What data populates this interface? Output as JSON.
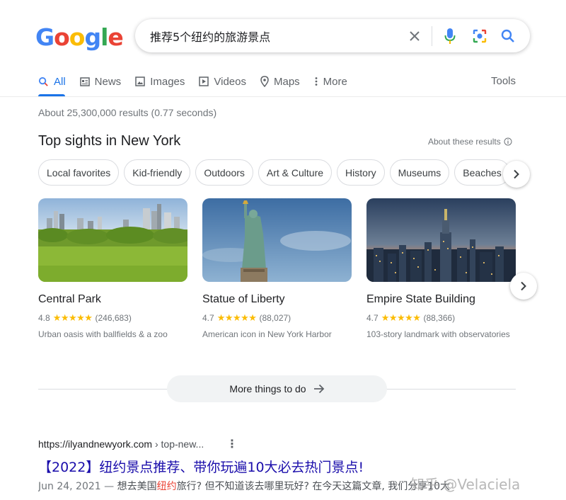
{
  "logo": [
    "G",
    "o",
    "o",
    "g",
    "l",
    "e"
  ],
  "search": {
    "query": "推荐5个纽约的旅游景点",
    "icons": [
      "clear-icon",
      "microphone-icon",
      "camera-lens-icon",
      "search-icon"
    ]
  },
  "tabs": [
    {
      "label": "All",
      "icon": "search-icon",
      "active": true
    },
    {
      "label": "News",
      "icon": "news-icon"
    },
    {
      "label": "Images",
      "icon": "image-icon"
    },
    {
      "label": "Videos",
      "icon": "play-icon"
    },
    {
      "label": "Maps",
      "icon": "map-pin-icon"
    },
    {
      "label": "More",
      "icon": "more-vertical-icon"
    }
  ],
  "tools_label": "Tools",
  "stats": "About 25,300,000 results (0.77 seconds)",
  "sights": {
    "title": "Top sights in New York",
    "about": "About these results",
    "chips": [
      "Local favorites",
      "Kid-friendly",
      "Outdoors",
      "Art & Culture",
      "History",
      "Museums",
      "Beaches"
    ],
    "cards": [
      {
        "name": "Central Park",
        "rating": "4.8",
        "stars": "★★★★★",
        "reviews": "(246,683)",
        "desc": "Urban oasis with ballfields & a zoo"
      },
      {
        "name": "Statue of Liberty",
        "rating": "4.7",
        "stars": "★★★★★",
        "reviews": "(88,027)",
        "desc": "American icon in New York Harbor"
      },
      {
        "name": "Empire State Building",
        "rating": "4.7",
        "stars": "★★★★★",
        "reviews": "(88,366)",
        "desc": "103-story landmark with observatories"
      }
    ],
    "more_things": "More things to do"
  },
  "result": {
    "url": "https://ilyandnewyork.com",
    "path": " › top-new...",
    "dots": "⋮",
    "title": "【2022】纽约景点推荐、带你玩遍10大必去热门景点!",
    "date": "Jun 24, 2021 — ",
    "snippet_pre": "想去美国",
    "snippet_hl": "纽约",
    "snippet_post": "旅行? 但不知道该去哪里玩好? 在今天这篇文章, 我们分享10大"
  },
  "watermark": "知乎 @Velaciela",
  "colors": {
    "accent": "#1a73e8",
    "link": "#1a0dab",
    "star": "#fbbc04"
  }
}
